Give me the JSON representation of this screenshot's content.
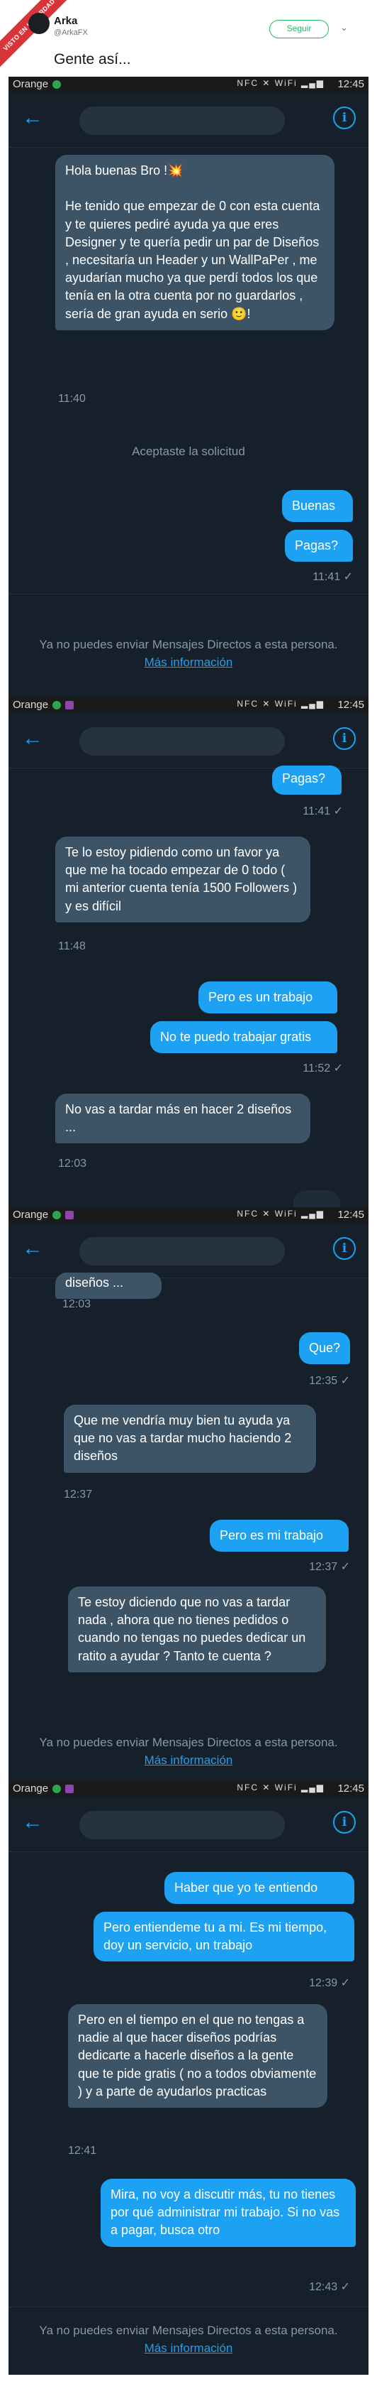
{
  "tweet": {
    "ribbon": "VISTO EN LAVERDAD",
    "author_name": "Arka",
    "author_handle": "@ArkaFX",
    "follow_label": "Seguir",
    "text": "Gente así..."
  },
  "status_bar": {
    "carrier": "Orange",
    "time": "12:45",
    "icons": "NFC ✕ WiFi ▂▄▆"
  },
  "icons": {
    "back": "back-arrow-icon",
    "info": "info-icon"
  },
  "panel1": {
    "msg1": "Hola buenas Bro !💥\n\nHe tenido que empezar de 0 con esta cuenta y te quieres pediré ayuda ya que eres Designer y te quería pedir un par de Diseños , necesitaría un Header y un WallPaPer , me ayudarían mucho ya que perdí todos los que tenía en la otra cuenta por no guardarlos , sería de gran ayuda en serio 🙂!",
    "time1": "11:40",
    "system": "Aceptaste la solicitud",
    "out1": "Buenas",
    "out2": "Pagas?",
    "time2": "11:41 ✓",
    "notice": "Ya no puedes enviar Mensajes Directos a esta persona.",
    "more": "Más información"
  },
  "panel2": {
    "peek": "Pagas?",
    "peek_time": "11:41 ✓",
    "msg1": "Te lo estoy pidiendo como un favor ya que me ha tocado empezar de 0 todo ( mi anterior cuenta tenía 1500 Followers ) y es difícil",
    "time1": "11:48",
    "out1": "Pero es un trabajo",
    "out2": "No te puedo trabajar gratis",
    "time2": "11:52 ✓",
    "msg2": "No vas a tardar más en hacer 2 diseños ...",
    "time3": "12:03"
  },
  "panel3": {
    "peek": "diseños ...",
    "peek_time": "12:03",
    "out1": "Que?",
    "time1": "12:35 ✓",
    "msg1": "Que me vendría muy bien tu ayuda ya que no vas a tardar mucho haciendo 2 diseños",
    "time2": "12:37",
    "out2": "Pero es mi trabajo",
    "time3": "12:37 ✓",
    "msg2": "Te estoy diciendo que no vas a tardar nada , ahora que no tienes pedidos o cuando no tengas no puedes dedicar un ratito a ayudar ? Tanto te cuenta ?",
    "notice": "Ya no puedes enviar Mensajes Directos a esta persona.",
    "more": "Más información"
  },
  "panel4": {
    "out1": "Haber que yo te entiendo",
    "out2": "Pero entiendeme tu a mi. Es mi tiempo, doy un servicio, un trabajo",
    "time1": "12:39 ✓",
    "msg1": "Pero en el tiempo en el que no tengas a nadie al que hacer diseños podrías dedicarte a hacerle diseños a la gente que te pide gratis ( no a todos obviamente ) y a parte de ayudarlos practicas",
    "time2": "12:41",
    "out3": "Mira, no voy a discutir más, tu no tienes por qué administrar mi trabajo. Si no vas a pagar, busca otro",
    "time3": "12:43 ✓",
    "notice": "Ya no puedes enviar Mensajes Directos a esta persona.",
    "more": "Más información"
  }
}
